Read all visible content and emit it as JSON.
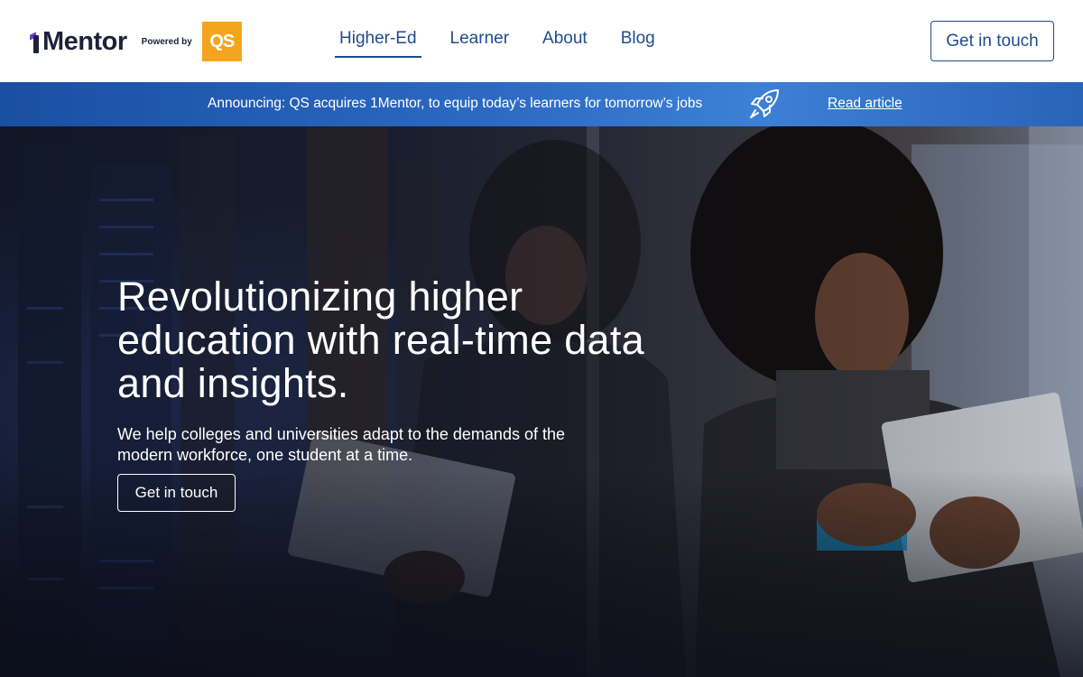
{
  "header": {
    "logo_text": "Mentor",
    "powered_by": "Powered by",
    "qs_logo_text": "QS",
    "nav": [
      {
        "label": "Higher-Ed",
        "active": true
      },
      {
        "label": "Learner",
        "active": false
      },
      {
        "label": "About",
        "active": false
      },
      {
        "label": "Blog",
        "active": false
      }
    ],
    "cta_label": "Get in touch"
  },
  "announcement": {
    "text": "Announcing: QS acquires 1Mentor, to equip today’s learners for tomorrow’s jobs",
    "icon": "rocket-icon",
    "link_label": "Read article"
  },
  "hero": {
    "title": "Revolutionizing higher education with real-time data and insights.",
    "subtitle": "We help colleges and universities adapt to the demands of the modern workforce, one student at a time.",
    "cta_label": "Get in touch"
  },
  "colors": {
    "brand_navy": "#1e2238",
    "brand_purple": "#6b3fd1",
    "link_blue": "#1f4b8f",
    "qs_orange": "#f5a51c",
    "announce_blue": "#2c69c2"
  }
}
